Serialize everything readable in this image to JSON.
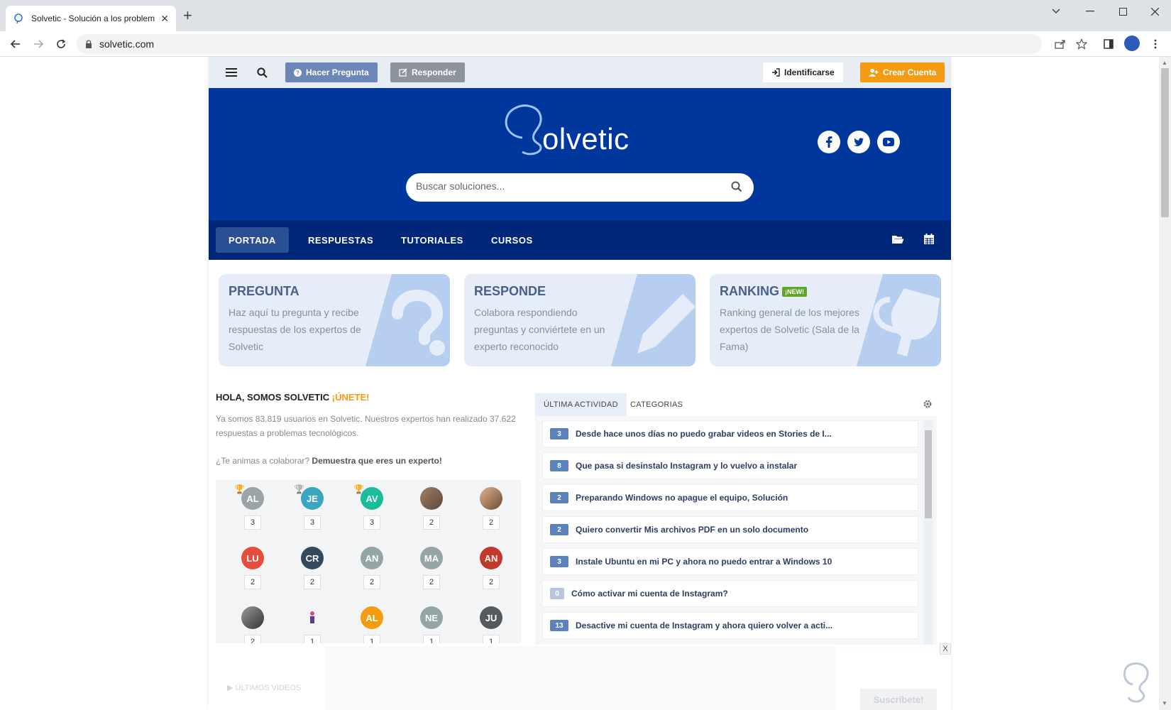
{
  "browser": {
    "tab_title": "Solvetic - Solución a los problem",
    "url": "solvetic.com"
  },
  "topbar": {
    "ask_label": "Hacer Pregunta",
    "answer_label": "Responder",
    "login_label": "Identificarse",
    "create_label": "Crear Cuenta"
  },
  "hero": {
    "logo_text": "olvetic",
    "search_placeholder": "Buscar soluciones..."
  },
  "nav": {
    "items": [
      "PORTADA",
      "RESPUESTAS",
      "TUTORIALES",
      "CURSOS"
    ]
  },
  "cards": [
    {
      "title": "PREGUNTA",
      "text": "Haz aquí tu pregunta y recibe respuestas de los expertos de Solvetic"
    },
    {
      "title": "RESPONDE",
      "text": "Colabora respondiendo preguntas y conviértete en un experto reconocido"
    },
    {
      "title": "RANKING",
      "badge": "¡NEW!",
      "text": "Ranking general de los mejores expertos de Solvetic (Sala de la Fama)"
    }
  ],
  "welcome": {
    "heading": "HOLA, SOMOS SOLVETIC",
    "join": "¡ÚNETE!",
    "intro": "Ya somos 83.819 usuarios en Solvetic. Nuestros expertos han realizado 37.622 respuestas a problemas tecnológicos.",
    "cta_prefix": "¿Te animas a colaborar?",
    "cta_bold": "Demuestra que eres un experto!"
  },
  "users": [
    {
      "initials": "AL",
      "count": "3",
      "color": "#9aa3a6"
    },
    {
      "initials": "JE",
      "count": "3",
      "color": "#3aa6c0"
    },
    {
      "initials": "AV",
      "count": "3",
      "color": "#1bbc9b"
    },
    {
      "initials": "",
      "count": "2",
      "color": "#8a6d5a"
    },
    {
      "initials": "",
      "count": "2",
      "color": "#b98a6a"
    },
    {
      "initials": "LU",
      "count": "2",
      "color": "#e74c3c"
    },
    {
      "initials": "CR",
      "count": "2",
      "color": "#34495e"
    },
    {
      "initials": "AN",
      "count": "2",
      "color": "#95a5a6"
    },
    {
      "initials": "MA",
      "count": "2",
      "color": "#95a5a6"
    },
    {
      "initials": "AN",
      "count": "2",
      "color": "#c0392b"
    },
    {
      "initials": "",
      "count": "2",
      "color": "#555555"
    },
    {
      "initials": "",
      "count": "1",
      "color": "#f3f4f6"
    },
    {
      "initials": "AL",
      "count": "1",
      "color": "#f39c12"
    },
    {
      "initials": "NE",
      "count": "1",
      "color": "#95a5a6"
    },
    {
      "initials": "JU",
      "count": "1",
      "color": "#555a5e"
    }
  ],
  "activity": {
    "tab_active": "ÚLTIMA ACTIVIDAD",
    "tab_other": "CATEGORIAS",
    "items": [
      {
        "count": "3",
        "title": "Desde hace unos días no puedo grabar videos en Stories de I..."
      },
      {
        "count": "8",
        "title": "Que pasa si desinstalo Instagram y lo vuelvo a instalar"
      },
      {
        "count": "2",
        "title": "Preparando Windows no apague el equipo, Solución"
      },
      {
        "count": "2",
        "title": "Quiero convertir Mis archivos PDF en un solo documento"
      },
      {
        "count": "3",
        "title": "Instale Ubuntu en mi PC y ahora no puedo entrar a Windows 10"
      },
      {
        "count": "0",
        "title": "Cómo activar mi cuenta de Instagram?"
      },
      {
        "count": "13",
        "title": "Desactive mi cuenta de Instagram y ahora quiero volver a acti..."
      }
    ]
  },
  "footer": {
    "videos_label": "ÚLTIMOS VIDEOS",
    "subscribe_label": "Suscribete!",
    "ad_close": "X"
  }
}
